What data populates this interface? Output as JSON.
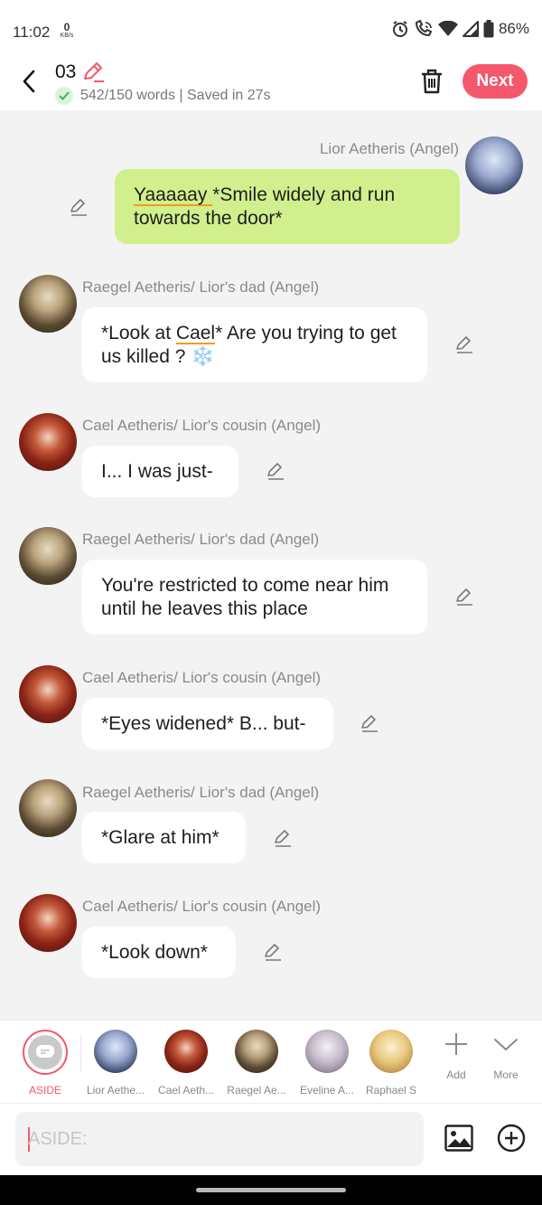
{
  "status_bar": {
    "time": "11:02",
    "net_speed_value": "0",
    "net_speed_unit": "KB/s",
    "battery": "86%",
    "icons": [
      "alarm-icon",
      "wifi-call-icon",
      "wifi-icon",
      "signal-icon",
      "battery-icon"
    ]
  },
  "header": {
    "title": "03",
    "subtitle": "542/150 words | Saved in 27s",
    "next_label": "Next",
    "accent_color": "#f5576c"
  },
  "messages": [
    {
      "speaker": "Lior Aetheris (Angel)",
      "side": "right",
      "avatar": "lior",
      "text_underlined": "Yaaaaay ",
      "text_rest": "*Smile widely and run towards the door*"
    },
    {
      "speaker": "Raegel Aetheris/ Lior's dad (Angel)",
      "side": "left",
      "avatar": "raegel",
      "text_a": "*Look at ",
      "text_underlined": "Cael",
      "text_b": "* Are you trying to get us killed ? ",
      "emoji": "❄️"
    },
    {
      "speaker": "Cael Aetheris/ Lior's cousin (Angel)",
      "side": "left",
      "avatar": "cael",
      "text": "I... I was just-"
    },
    {
      "speaker": "Raegel Aetheris/ Lior's dad (Angel)",
      "side": "left",
      "avatar": "raegel",
      "text": "You're restricted to come near him until he leaves this place"
    },
    {
      "speaker": "Cael Aetheris/ Lior's cousin (Angel)",
      "side": "left",
      "avatar": "cael",
      "text": "*Eyes widened* B... but-"
    },
    {
      "speaker": "Raegel Aetheris/ Lior's dad (Angel)",
      "side": "left",
      "avatar": "raegel",
      "text": "*Glare at him*"
    },
    {
      "speaker": "Cael Aetheris/ Lior's cousin (Angel)",
      "side": "left",
      "avatar": "cael",
      "text": "*Look down*"
    }
  ],
  "character_bar": {
    "aside_label": "ASIDE",
    "characters": [
      {
        "label": "Lior Aethe...",
        "avatar": "lior"
      },
      {
        "label": "Cael Aeth...",
        "avatar": "cael"
      },
      {
        "label": "Raegel Ae...",
        "avatar": "raegel"
      },
      {
        "label": "Eveline A...",
        "avatar": "eveline"
      },
      {
        "label": "Raphael S",
        "avatar": "raphael"
      }
    ],
    "add_label": "Add",
    "more_label": "More"
  },
  "input_bar": {
    "placeholder": "ASIDE:",
    "value": ""
  }
}
